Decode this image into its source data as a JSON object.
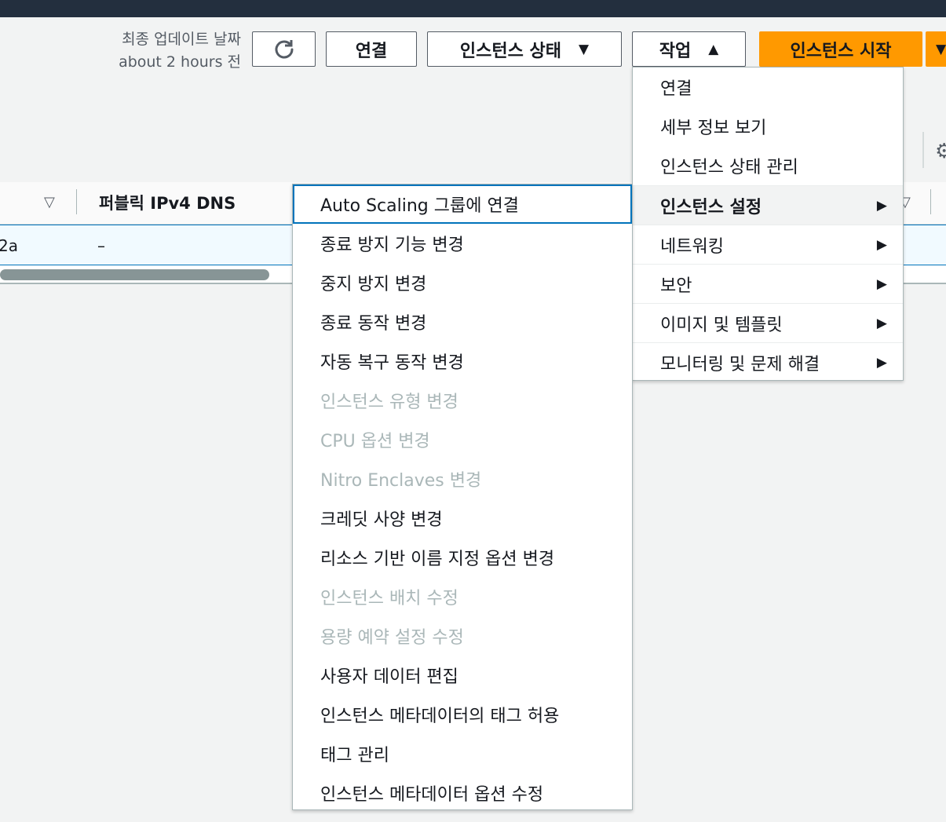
{
  "header": {
    "last_updated_label": "최종 업데이트 날짜",
    "last_updated_value": "about 2 hours 전"
  },
  "toolbar": {
    "refresh_icon": "refresh-icon",
    "connect_label": "연결",
    "instance_state_label": "인스턴스 상태",
    "actions_label": "작업",
    "launch_label": "인스턴스 시작"
  },
  "table": {
    "column_header": "퍼블릭 IPv4 DNS",
    "row": {
      "left_cell": "2a",
      "dns_cell": "–"
    }
  },
  "actions_menu": {
    "items": [
      {
        "label": "연결"
      },
      {
        "label": "세부 정보 보기"
      },
      {
        "label": "인스턴스 상태 관리"
      },
      {
        "label": "인스턴스 설정"
      },
      {
        "label": "네트워킹"
      },
      {
        "label": "보안"
      },
      {
        "label": "이미지 및 템플릿"
      },
      {
        "label": "모니터링 및 문제 해결"
      }
    ]
  },
  "settings_menu": {
    "items": [
      {
        "label": "Auto Scaling 그룹에 연결"
      },
      {
        "label": "종료 방지 기능 변경"
      },
      {
        "label": "중지 방지 변경"
      },
      {
        "label": "종료 동작 변경"
      },
      {
        "label": "자동 복구 동작 변경"
      },
      {
        "label": "인스턴스 유형 변경"
      },
      {
        "label": "CPU 옵션 변경"
      },
      {
        "label": "Nitro Enclaves 변경"
      },
      {
        "label": "크레딧 사양 변경"
      },
      {
        "label": "리소스 기반 이름 지정 옵션 변경"
      },
      {
        "label": "인스턴스 배치 수정"
      },
      {
        "label": "용량 예약 설정 수정"
      },
      {
        "label": "사용자 데이터 편집"
      },
      {
        "label": "인스턴스 메타데이터의 태그 허용"
      },
      {
        "label": "태그 관리"
      },
      {
        "label": "인스턴스 메타데이터 옵션 수정"
      }
    ]
  }
}
